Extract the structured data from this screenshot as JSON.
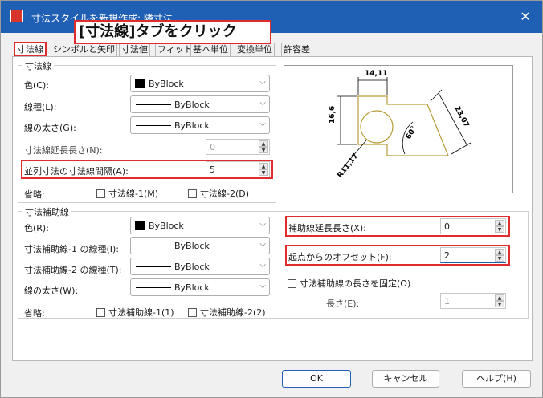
{
  "window": {
    "title": "寸法スタイルを新規作成: 隣寸法",
    "close": "✕"
  },
  "callout": "[寸法線]タブをクリック",
  "tabs": [
    {
      "label": "寸法線"
    },
    {
      "label": "シンボルと矢印"
    },
    {
      "label": "寸法値"
    },
    {
      "label": "フィット"
    },
    {
      "label": "基本単位"
    },
    {
      "label": "変換単位"
    },
    {
      "label": "許容差"
    }
  ],
  "dimline": {
    "group_title": "寸法線",
    "color_label": "色(C):",
    "color_value": "ByBlock",
    "linetype_label": "線種(L):",
    "linetype_value": "ByBlock",
    "lineweight_label": "線の太さ(G):",
    "lineweight_value": "ByBlock",
    "ext_label": "寸法線延長長さ(N):",
    "ext_value": "0",
    "baseline_label": "並列寸法の寸法線間隔(A):",
    "baseline_value": "5",
    "suppress_label": "省略:",
    "suppress1": "寸法線-1(M)",
    "suppress2": "寸法線-2(D)"
  },
  "extline": {
    "group_title": "寸法補助線",
    "color_label": "色(R):",
    "color_value": "ByBlock",
    "lt1_label": "寸法補助線-1 の線種(I):",
    "lt1_value": "ByBlock",
    "lt2_label": "寸法補助線-2 の線種(T):",
    "lt2_value": "ByBlock",
    "lw_label": "線の太さ(W):",
    "lw_value": "ByBlock",
    "suppress_label": "省略:",
    "suppress1": "寸法補助線-1(1)",
    "suppress2": "寸法補助線-2(2)",
    "beyond_label": "補助線延長長さ(X):",
    "beyond_value": "0",
    "offset_label": "起点からのオフセット(F):",
    "offset_value": "2",
    "fixed_label": "寸法補助線の長さを固定(O)",
    "length_label": "長さ(E):",
    "length_value": "1"
  },
  "preview": {
    "d1": "14,11",
    "d2": "16,6",
    "d3": "23,07",
    "d4": "60°",
    "d5": "R11,17"
  },
  "buttons": {
    "ok": "OK",
    "cancel": "キャンセル",
    "help": "ヘルプ(H)"
  }
}
